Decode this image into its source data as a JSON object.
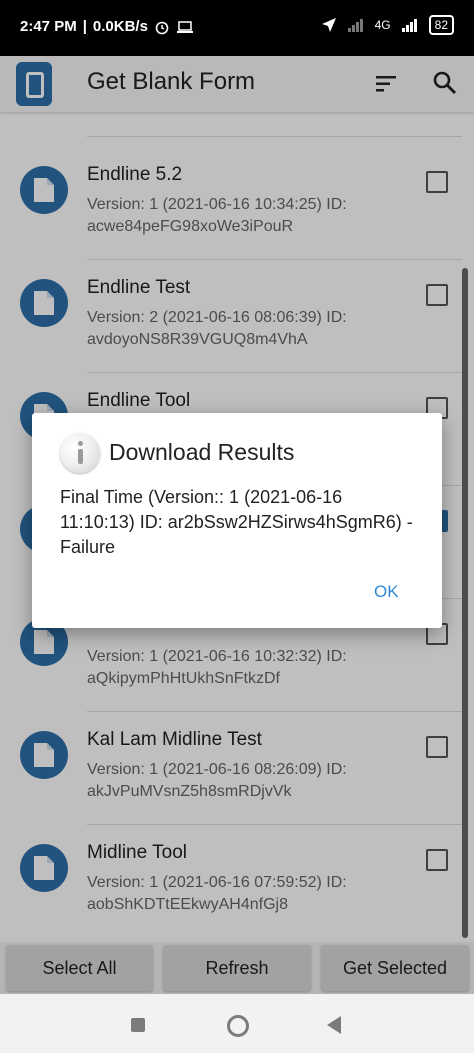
{
  "status_bar": {
    "time": "2:47 PM",
    "speed": "0.0KB/s",
    "network": "4G",
    "battery": "82"
  },
  "app_bar": {
    "title": "Get Blank Form"
  },
  "forms": [
    {
      "name": "Endline 5.2",
      "details": "Version: 1 (2021-06-16 10:34:25) ID: acwe84peFG98xoWe3iPouR",
      "checked": false
    },
    {
      "name": "Endline Test",
      "details": "Version: 2 (2021-06-16 08:06:39) ID: avdoyoNS8R39VGUQ8m4VhA",
      "checked": false
    },
    {
      "name": "Endline Tool",
      "details": "",
      "checked": false
    },
    {
      "name": "",
      "details": "",
      "checked": true
    },
    {
      "name": "",
      "details": "Version: 1 (2021-06-16 10:32:32) ID: aQkipymPhHtUkhSnFtkzDf",
      "checked": false
    },
    {
      "name": "Kal Lam Midline Test",
      "details": "Version: 1 (2021-06-16 08:26:09) ID: akJvPuMVsnZ5h8smRDjvVk",
      "checked": false
    },
    {
      "name": "Midline Tool",
      "details": "Version: 1 (2021-06-16 07:59:52) ID: aobShKDTtEEkwyAH4nfGj8",
      "checked": false
    }
  ],
  "actions": {
    "select_all": "Select All",
    "refresh": "Refresh",
    "get_selected": "Get Selected"
  },
  "dialog": {
    "title": "Download Results",
    "message": "Final Time (Version:: 1 (2021-06-16 11:10:13) ID: ar2bSsw2HZSirws4hSgmR6) - Failure",
    "ok_label": "OK"
  },
  "colors": {
    "accent": "#2d6fa8",
    "dialog_button": "#2d8ad6"
  },
  "icons": [
    "app-logo",
    "sort-icon",
    "search-icon",
    "document-icon",
    "info-icon",
    "nav-recents-icon",
    "nav-home-icon",
    "nav-back-icon"
  ]
}
